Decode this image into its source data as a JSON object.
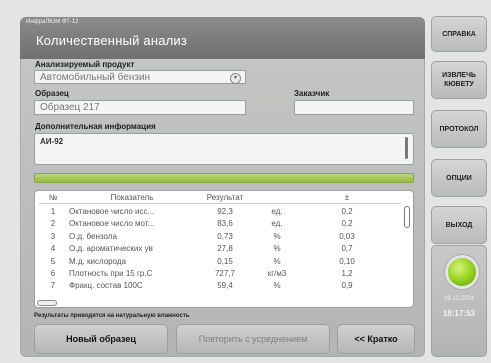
{
  "window": {
    "title": "ИнфраЛЮМ ФТ-12"
  },
  "page": {
    "title": "Количественный анализ"
  },
  "form": {
    "product_label": "Анализируемый продукт",
    "product_value": "Автомобильный бензин",
    "sample_label": "Образец",
    "sample_value": "Образец 217",
    "customer_label": "Заказчик",
    "customer_value": "",
    "info_label": "Дополнительная информация",
    "info_value": "АИ-92"
  },
  "progress": {
    "value": 1.0
  },
  "table": {
    "columns": [
      "№",
      "Показатель",
      "Результат",
      "",
      "±"
    ],
    "rows": [
      [
        "1",
        "Октановое число исс...",
        "92,3",
        "ед.",
        "0,2"
      ],
      [
        "2",
        "Октановое число мот...",
        "83,6",
        "ед.",
        "0,2"
      ],
      [
        "3",
        "О.д. бензола",
        "0,73",
        "%",
        "0,03"
      ],
      [
        "4",
        "О.д. ароматических ув",
        "27,8",
        "%",
        "0,7"
      ],
      [
        "5",
        "М.д. кислорода",
        "0,15",
        "%",
        "0,10"
      ],
      [
        "6",
        "Плотность при 15 гр.С",
        "727,7",
        "кг/м3",
        "1,2"
      ],
      [
        "7",
        "Фракц. состав 100С",
        "59,4",
        "%",
        "0,9"
      ]
    ]
  },
  "footnote": "Результаты приводятся на натуральную влажность",
  "buttons": {
    "new_sample": "Новый образец",
    "repeat_averaging": "Повторить с усреднением",
    "brief": "<< Кратко"
  },
  "sidebar": {
    "help": "СПРАВКА",
    "eject_line1": "ИЗВЛЕЧЬ",
    "eject_line2": "КЮВЕТУ",
    "protocol": "ПРОТОКОЛ",
    "options": "ОПЦИИ",
    "exit": "ВЫХОД"
  },
  "status": {
    "indicator_color": "#8fd017",
    "date": "09.10.2024",
    "time": "18:17:53"
  }
}
